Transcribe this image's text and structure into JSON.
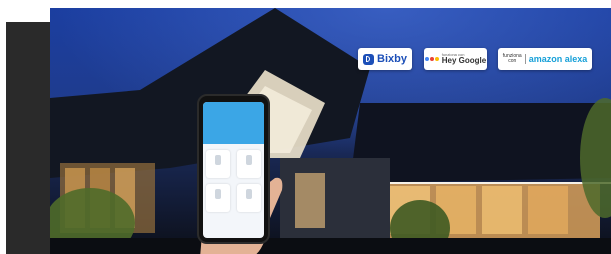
{
  "badges": {
    "bixby": {
      "text": "Bixby",
      "color": "#1c4fb8"
    },
    "google": {
      "small": "funziona con",
      "big": "Hey Google",
      "dot_colors": [
        "#4285F4",
        "#EA4335",
        "#FBBC05",
        "#34A853"
      ]
    },
    "alexa": {
      "left_line1": "funziona",
      "left_line2": "con",
      "right": "amazon alexa",
      "color": "#17a0d8"
    }
  },
  "phone": {
    "accent": "#3ba6e6"
  },
  "colors": {
    "sky": "#1b3ea0",
    "panel": "#2a2a2a",
    "warm_light": "#f2c57a"
  }
}
